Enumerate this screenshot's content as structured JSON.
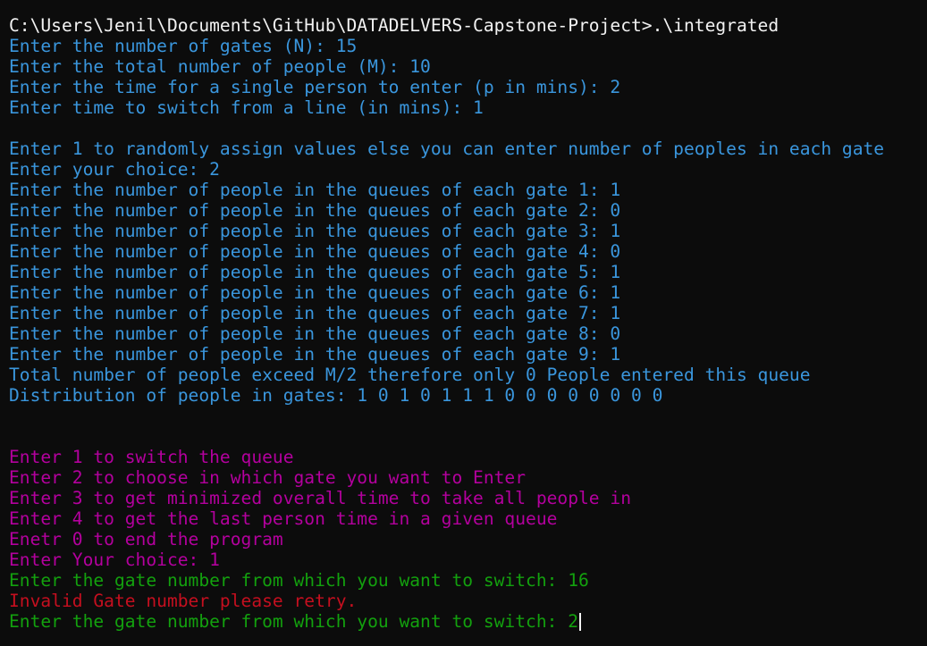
{
  "colors": {
    "background": "#0c0c0c",
    "white": "#f2f2f2",
    "blue": "#3a96dd",
    "magenta": "#b4009e",
    "green": "#13a10e",
    "red": "#c50f1f"
  },
  "terminal": {
    "lines": [
      {
        "text": "C:\\Users\\Jenil\\Documents\\GitHub\\DATADELVERS-Capstone-Project>.\\integrated",
        "color": "white"
      },
      {
        "text": "Enter the number of gates (N): 15",
        "color": "blue"
      },
      {
        "text": "Enter the total number of people (M): 10",
        "color": "blue"
      },
      {
        "text": "Enter the time for a single person to enter (p in mins): 2",
        "color": "blue"
      },
      {
        "text": "Enter time to switch from a line (in mins): 1",
        "color": "blue"
      },
      {
        "text": "",
        "color": "blue"
      },
      {
        "text": "Enter 1 to randomly assign values else you can enter number of peoples in each gate",
        "color": "blue"
      },
      {
        "text": "Enter your choice: 2",
        "color": "blue"
      },
      {
        "text": "Enter the number of people in the queues of each gate 1: 1",
        "color": "blue"
      },
      {
        "text": "Enter the number of people in the queues of each gate 2: 0",
        "color": "blue"
      },
      {
        "text": "Enter the number of people in the queues of each gate 3: 1",
        "color": "blue"
      },
      {
        "text": "Enter the number of people in the queues of each gate 4: 0",
        "color": "blue"
      },
      {
        "text": "Enter the number of people in the queues of each gate 5: 1",
        "color": "blue"
      },
      {
        "text": "Enter the number of people in the queues of each gate 6: 1",
        "color": "blue"
      },
      {
        "text": "Enter the number of people in the queues of each gate 7: 1",
        "color": "blue"
      },
      {
        "text": "Enter the number of people in the queues of each gate 8: 0",
        "color": "blue"
      },
      {
        "text": "Enter the number of people in the queues of each gate 9: 1",
        "color": "blue"
      },
      {
        "text": "Total number of people exceed M/2 therefore only 0 People entered this queue",
        "color": "blue"
      },
      {
        "text": "Distribution of people in gates: 1 0 1 0 1 1 1 0 0 0 0 0 0 0 0",
        "color": "blue"
      },
      {
        "text": "",
        "color": "blue"
      },
      {
        "text": "",
        "color": "blue"
      },
      {
        "text": "Enter 1 to switch the queue",
        "color": "magenta"
      },
      {
        "text": "Enter 2 to choose in which gate you want to Enter",
        "color": "magenta"
      },
      {
        "text": "Enter 3 to get minimized overall time to take all people in",
        "color": "magenta"
      },
      {
        "text": "Enter 4 to get the last person time in a given queue",
        "color": "magenta"
      },
      {
        "text": "Enetr 0 to end the program",
        "color": "magenta"
      },
      {
        "text": "Enter Your choice: 1",
        "color": "magenta"
      },
      {
        "text": "Enter the gate number from which you want to switch: 16",
        "color": "green"
      },
      {
        "text": "Invalid Gate number please retry.",
        "color": "red"
      },
      {
        "text": "Enter the gate number from which you want to switch: 2",
        "color": "green",
        "cursor": true
      }
    ]
  }
}
